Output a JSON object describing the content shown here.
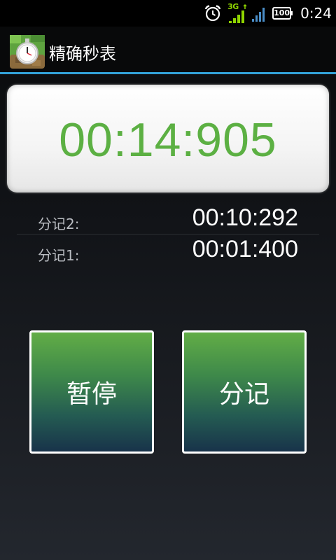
{
  "status_bar": {
    "network_type": "3G",
    "battery_level": "100",
    "time": "0:24",
    "icons": [
      "alarm-clock-icon",
      "mobile-signal-icon",
      "wifi-signal-icon",
      "battery-icon"
    ]
  },
  "app_bar": {
    "title": "精确秒表",
    "icon": "stopwatch-app-icon"
  },
  "timer": {
    "value": "00:14:905",
    "color": "#5cb043"
  },
  "laps": [
    {
      "label": "分记2:",
      "time": "00:10:292"
    },
    {
      "label": "分记1:",
      "time": "00:01:400"
    }
  ],
  "buttons": {
    "pause_label": "暂停",
    "lap_label": "分记"
  },
  "colors": {
    "accent_line": "#33a2d8",
    "button_top": "#62ad46",
    "button_bottom": "#18334a"
  }
}
